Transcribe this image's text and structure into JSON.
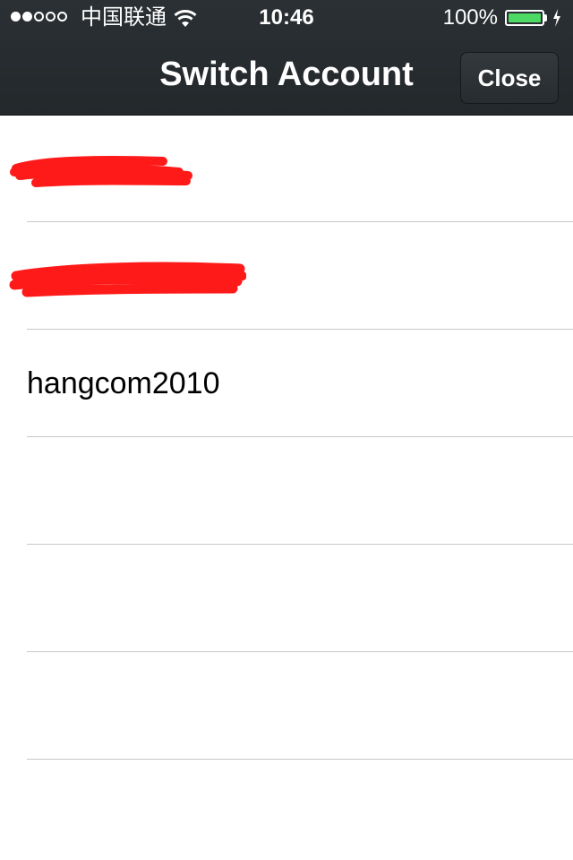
{
  "status_bar": {
    "carrier": "中国联通",
    "time": "10:46",
    "battery_percent": "100%",
    "battery_level": 1.0,
    "signal_bars_filled": 2,
    "signal_bars_total": 5
  },
  "nav": {
    "title": "Switch Account",
    "close_label": "Close"
  },
  "accounts": [
    {
      "label": "",
      "redacted": true
    },
    {
      "label": "",
      "redacted": true
    },
    {
      "label": "hangcom2010",
      "redacted": false
    },
    {
      "label": "",
      "redacted": false
    },
    {
      "label": "",
      "redacted": false
    },
    {
      "label": "",
      "redacted": false
    }
  ],
  "colors": {
    "header_bg": "#23282b",
    "battery_green": "#4cd964",
    "redaction_red": "#ff1a1a",
    "separator": "#c8c7cc"
  }
}
